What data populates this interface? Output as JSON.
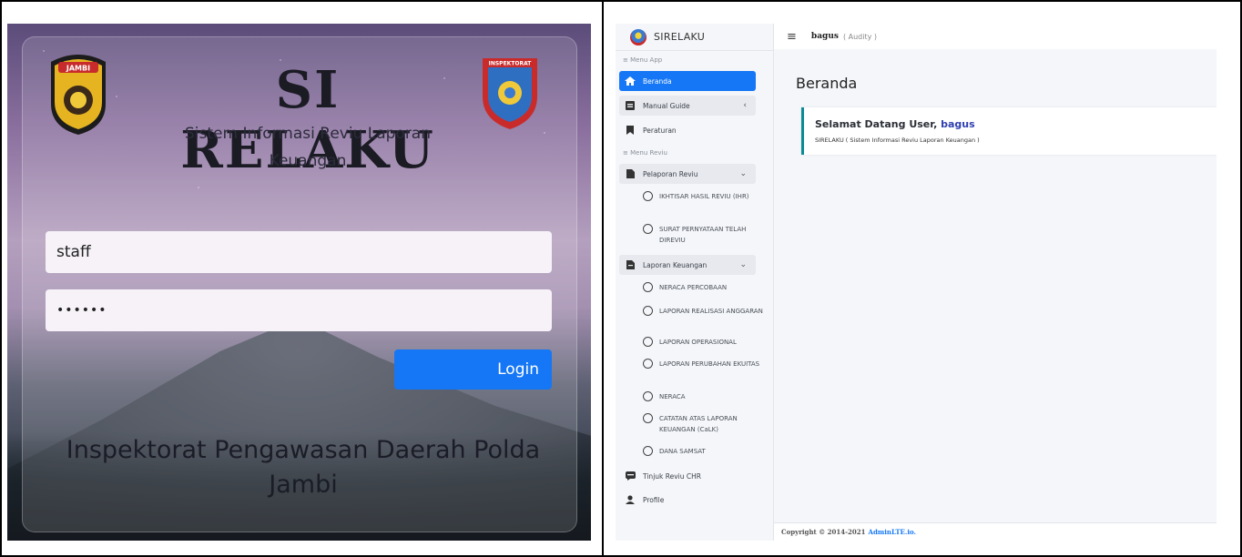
{
  "login": {
    "title": "SI RELAKU",
    "subtitle": "Sistem Informasi Reviu Laporan Keuangan",
    "username_value": "staff",
    "password_value": "••••••",
    "login_button": "Login",
    "footer": "Inspektorat Pengawasan Daerah Polda Jambi",
    "left_badge_text": "JAMBI",
    "right_badge_text": "INSPEKTORAT",
    "button_color": "#1577f5"
  },
  "app": {
    "brand": "SIRELAKU",
    "topbar": {
      "username": "bagus",
      "role": "( Audity )"
    },
    "sidebar": {
      "header_app": "≡ Menu App",
      "header_reviu": "≡ Menu Reviu",
      "items": [
        {
          "label": "Beranda",
          "icon": "home-icon",
          "active": true
        },
        {
          "label": "Manual Guide",
          "icon": "book-icon",
          "chevron": "‹"
        },
        {
          "label": "Peraturan",
          "icon": "bookmark-icon"
        },
        {
          "label": "Pelaporan Reviu",
          "icon": "file-icon",
          "chevron": "⌄"
        },
        {
          "label": "Laporan Keuangan",
          "icon": "file-invoice-icon",
          "chevron": "⌄"
        },
        {
          "label": "Tinjuk Reviu CHR",
          "icon": "chat-icon"
        },
        {
          "label": "Profile",
          "icon": "user-icon"
        }
      ],
      "pelaporan_sub": [
        "IKHTISAR HASIL REVIU (IHR)",
        "SURAT PERNYATAAN TELAH DIREVIU"
      ],
      "laporan_sub": [
        "NERACA PERCOBAAN",
        "LAPORAN REALISASI ANGGARAN",
        "LAPORAN OPERASIONAL",
        "LAPORAN PERUBAHAN EKUITAS",
        "NERACA",
        "CATATAN ATAS LAPORAN KEUANGAN (CaLK)",
        "DANA SAMSAT"
      ]
    },
    "content": {
      "title": "Beranda",
      "welcome_prefix": "Selamat Datang User,",
      "welcome_user": "bagus",
      "welcome_sub": "SIRELAKU ( Sistem Informasi Reviu Laporan Keuangan )"
    },
    "footer": {
      "text": "Copyright © 2014-2021",
      "link": "AdminLTE.io."
    },
    "accent_color": "#1577f5"
  }
}
